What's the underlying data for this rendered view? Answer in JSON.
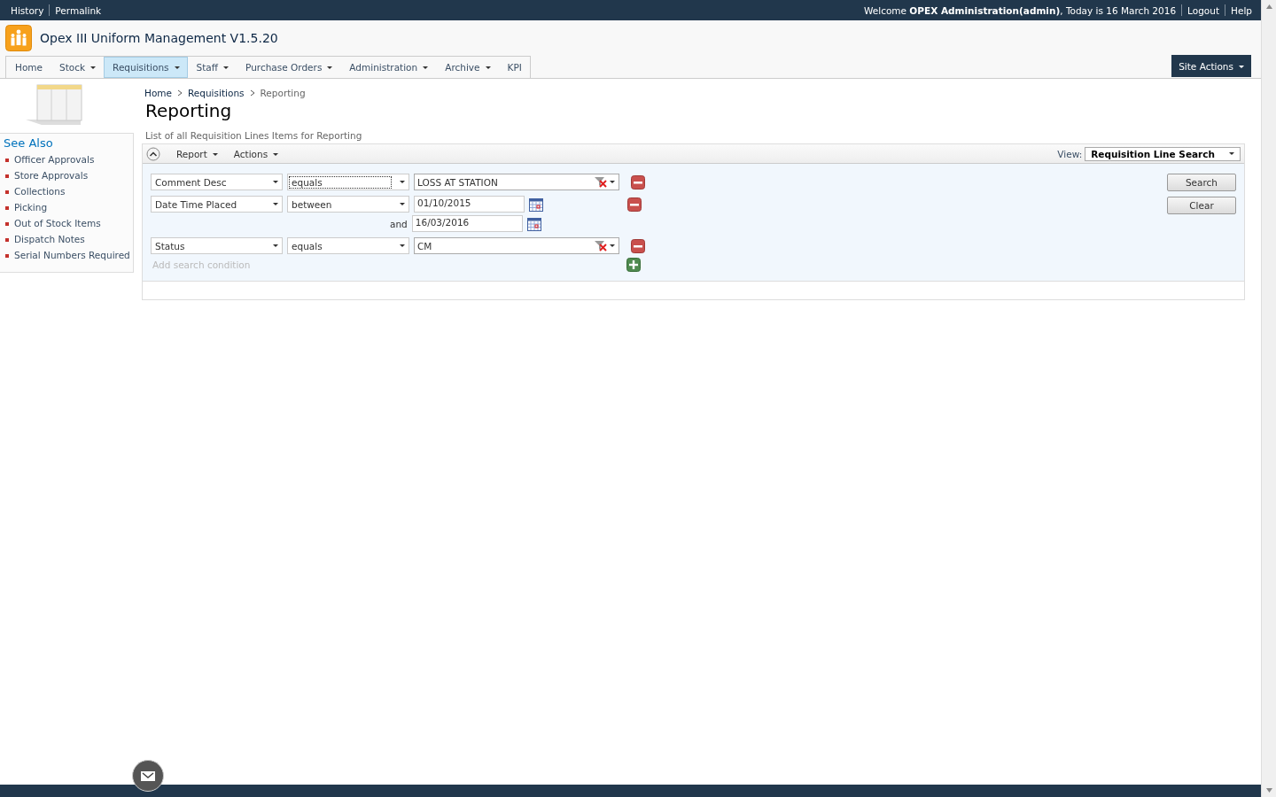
{
  "top_bar": {
    "links": [
      "History",
      "Permalink"
    ],
    "welcome": "Welcome **OPEX Administration(admin)**, Today is 16 March 2016",
    "right_links": [
      "Logout",
      "Help"
    ]
  },
  "site_title": "Opex III Uniform Management V1.5.20",
  "nav": [
    {
      "label": "Home",
      "menu": false,
      "selected": false
    },
    {
      "label": "Stock",
      "menu": true,
      "selected": false
    },
    {
      "label": "Requisitions",
      "menu": true,
      "selected": true
    },
    {
      "label": "Staff",
      "menu": true,
      "selected": false
    },
    {
      "label": "Purchase Orders",
      "menu": true,
      "selected": false
    },
    {
      "label": "Administration",
      "menu": true,
      "selected": false
    },
    {
      "label": "Archive",
      "menu": true,
      "selected": false
    },
    {
      "label": "KPI",
      "menu": false,
      "selected": false
    }
  ],
  "site_actions": "Site Actions",
  "sidebar": {
    "heading": "See Also",
    "items": [
      "Officer Approvals",
      "Store Approvals",
      "Collections",
      "Picking",
      "Out of Stock Items",
      "Dispatch Notes",
      "Serial Numbers Required"
    ]
  },
  "breadcrumb": [
    "Home",
    "Requisitions",
    "Reporting"
  ],
  "page_title": "Reporting",
  "description": "List of all Requisition Lines Items for Reporting",
  "toolbar": {
    "menus": [
      "Report",
      "Actions"
    ],
    "view_label": "View:",
    "view": "Requisition Line Search"
  },
  "conditions": [
    {
      "kind": "text",
      "field": "Comment Desc",
      "operator": "equals",
      "focused": true,
      "value": "LOSS AT STATION"
    },
    {
      "kind": "range",
      "field": "Date Time Placed",
      "operator": "between",
      "focused": false,
      "from": "01/10/2015",
      "joiner": "and",
      "to": "16/03/2016"
    },
    {
      "kind": "text",
      "field": "Status",
      "operator": "equals",
      "focused": false,
      "value": "CM"
    }
  ],
  "add_condition_placeholder": "Add search condition",
  "buttons": [
    "Search",
    "Clear"
  ]
}
